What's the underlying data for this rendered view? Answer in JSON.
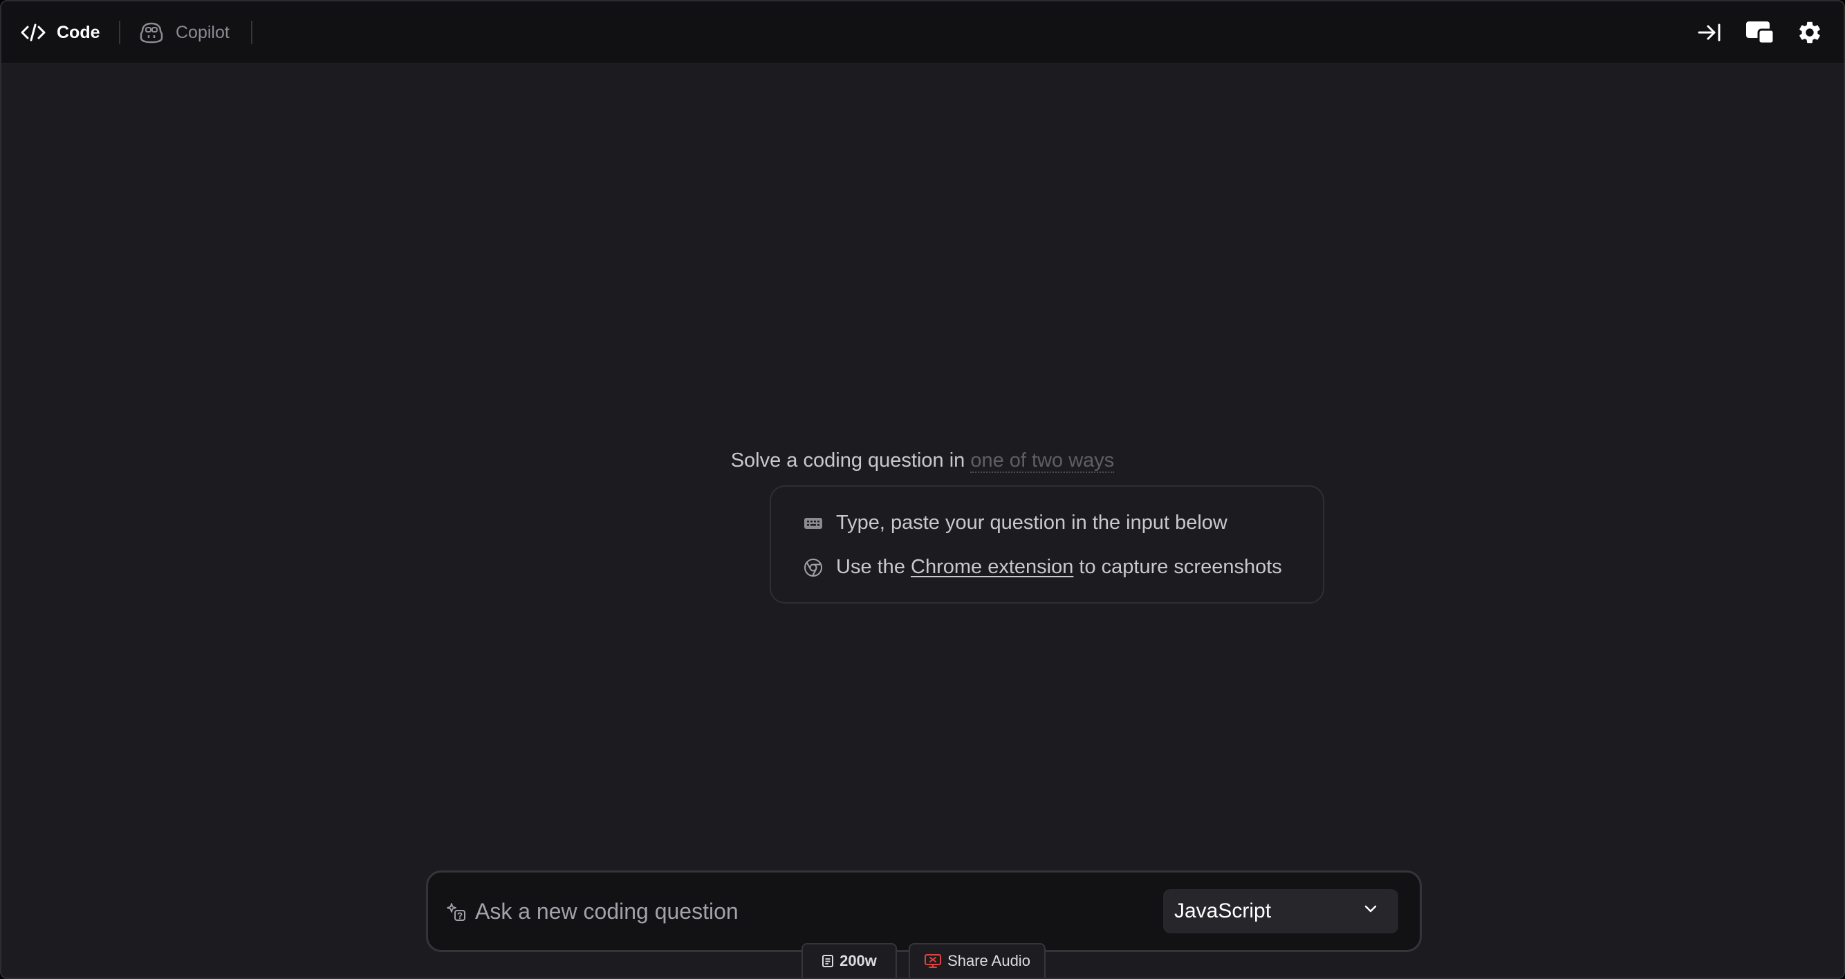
{
  "header": {
    "tabs": [
      {
        "label": "Code",
        "icon": "code-icon",
        "active": true
      },
      {
        "label": "Copilot",
        "icon": "copilot-icon",
        "active": false
      }
    ],
    "actions": [
      {
        "icon": "collapse-right-icon"
      },
      {
        "icon": "window-icon"
      },
      {
        "icon": "gear-icon"
      }
    ]
  },
  "intro": {
    "lead": "Solve a coding question in ",
    "link": "one of two ways",
    "ways": [
      {
        "icon": "keyboard-icon",
        "text": "Type, paste your question in the input below"
      },
      {
        "icon": "chrome-icon",
        "before": "Use the ",
        "link": "Chrome extension",
        "after": " to capture screenshots"
      }
    ]
  },
  "composer": {
    "icon": "sparkle-question-icon",
    "placeholder": "Ask a new coding question",
    "value": "",
    "language": "JavaScript",
    "chips": [
      {
        "icon": "document-icon",
        "label": "200w"
      },
      {
        "icon": "screen-share-icon",
        "label": "Share Audio",
        "icon_color": "#e0433f"
      }
    ]
  },
  "colors": {
    "background": "#1c1c20",
    "topbar": "#111114",
    "accent_red": "#e0433f",
    "muted_text": "#8b8b92"
  }
}
